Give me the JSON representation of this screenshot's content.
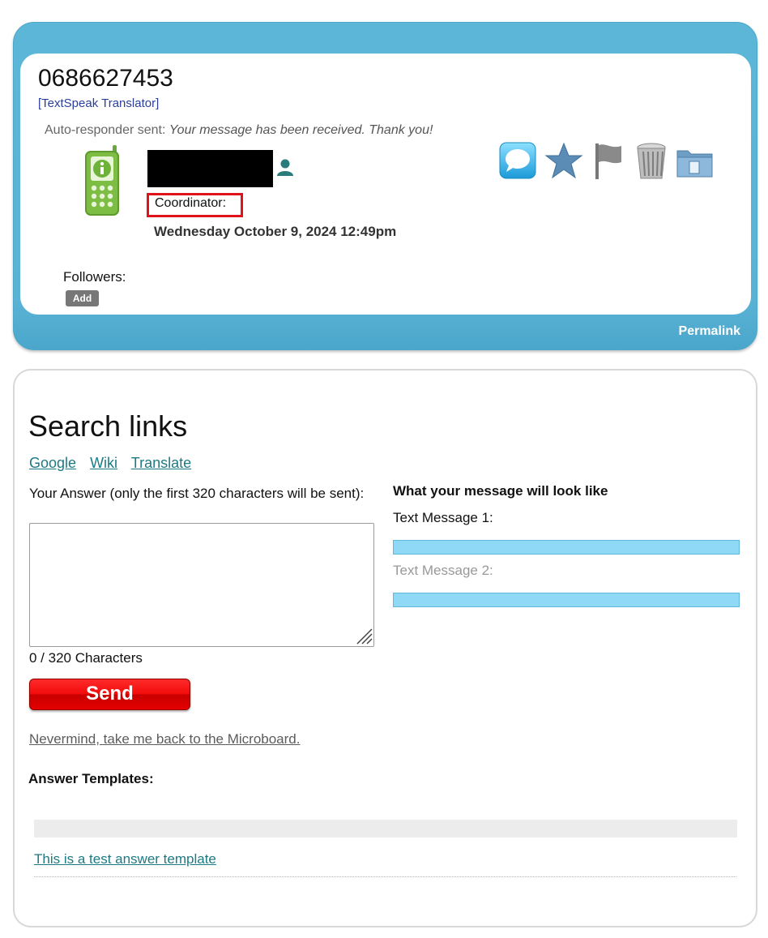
{
  "message": {
    "phone_number": "0686627453",
    "translator_link": "[TextSpeak Translator]",
    "auto_responder_prefix": "Auto-responder sent: ",
    "auto_responder_text": "Your message has been received. Thank you!",
    "coordinator_label": "Coordinator:",
    "date": "Wednesday October 9, 2024 12:49pm",
    "followers_label": "Followers:",
    "add_button": "Add",
    "permalink": "Permalink",
    "action_icons": [
      "reply-bubble-icon",
      "star-icon",
      "flag-icon",
      "trash-icon",
      "folder-icon"
    ],
    "colors": {
      "card_blue": "#5ab4d6",
      "highlight_red": "#e0131b"
    }
  },
  "search": {
    "title": "Search links",
    "links": [
      "Google",
      "Wiki",
      "Translate"
    ]
  },
  "answer": {
    "label": "Your Answer (only the first 320 characters will be sent):",
    "value": "",
    "char_count": "0 / 320 Characters",
    "send_button": "Send",
    "nevermind_link": "Nevermind, take me back to the Microboard."
  },
  "preview": {
    "title": "What your message will look like",
    "text_message_1": "Text Message 1:",
    "text_message_2": "Text Message 2:"
  },
  "templates": {
    "label": "Answer Templates:",
    "items": [
      "This is a test answer template"
    ]
  }
}
